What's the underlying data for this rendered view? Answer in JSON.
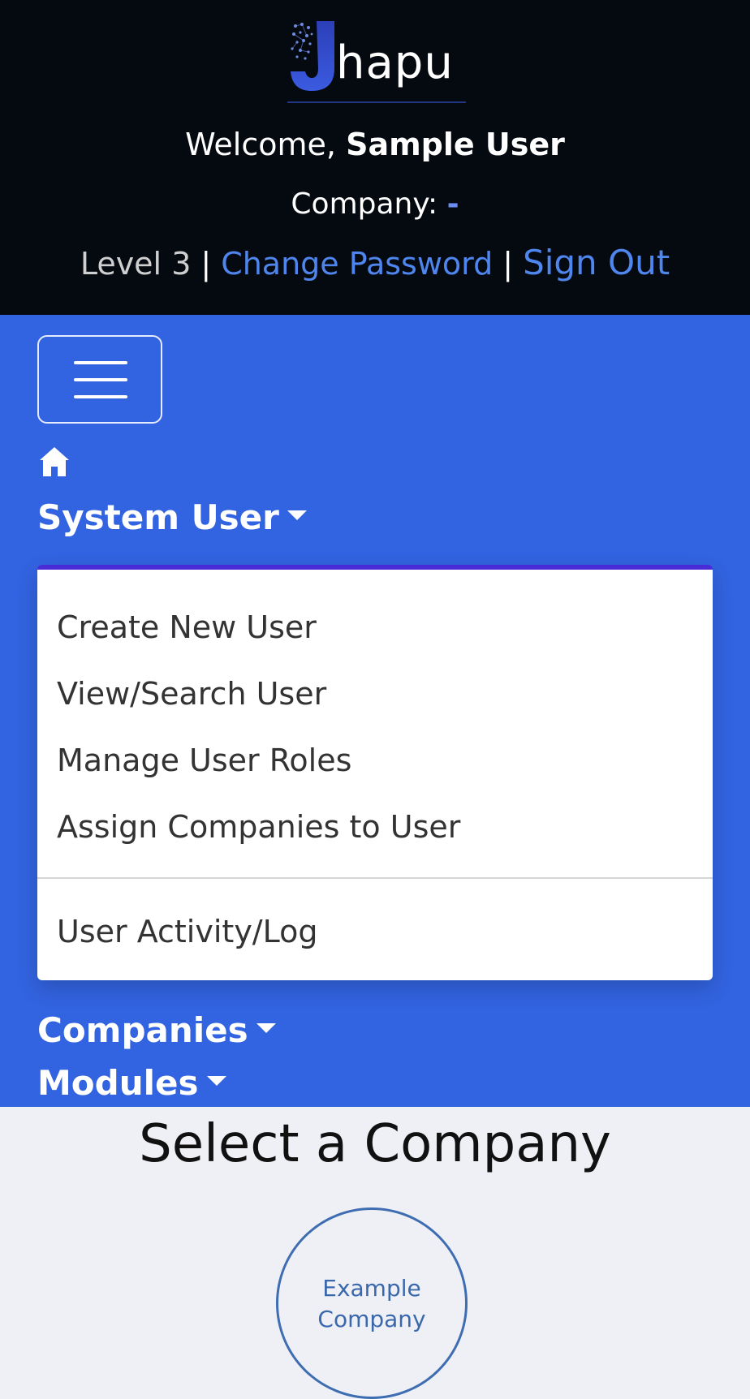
{
  "header": {
    "logo_text": "hapu",
    "welcome_prefix": "Welcome,",
    "user_name": "Sample User",
    "company_label": "Company:",
    "company_value": "-",
    "level": "Level 3",
    "separator": "|",
    "change_password": "Change Password",
    "sign_out": "Sign Out"
  },
  "nav": {
    "menu_toggle_icon": "hamburger-icon",
    "home_icon": "home-icon",
    "system_user": "System User",
    "companies": "Companies",
    "modules": "Modules"
  },
  "dropdown": {
    "items": [
      "Create New User",
      "View/Search User",
      "Manage User Roles",
      "Assign Companies to User"
    ],
    "after_divider": "User Activity/Log"
  },
  "main": {
    "title": "Select a Company",
    "company_card": "Example Company"
  },
  "colors": {
    "header_bg": "#050910",
    "nav_bg": "#3263e0",
    "link": "#4f86ee",
    "dropdown_accent": "#4a2bd8",
    "circle_border": "#3f6db2"
  }
}
